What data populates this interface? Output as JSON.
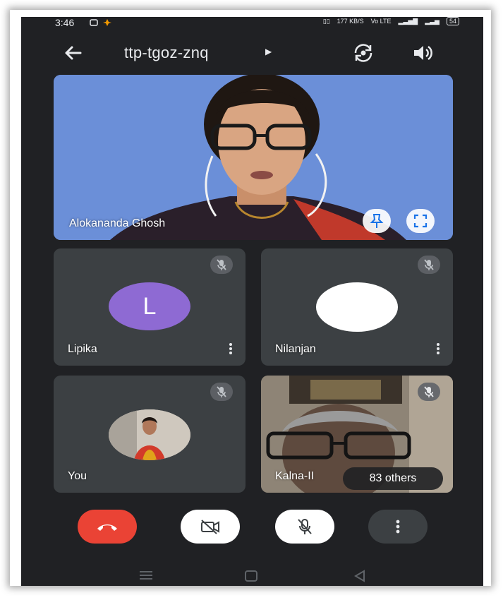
{
  "status_bar": {
    "time": "3:46",
    "network_speed": "177\nKB/S",
    "battery": "54"
  },
  "header": {
    "meeting_code": "ttp-tgoz-znq"
  },
  "main_tile": {
    "participant_name": "Alokananda Ghosh"
  },
  "tiles": [
    {
      "participant_name": "Lipika",
      "avatar_initial": "L",
      "avatar_color": "#8e6ad3",
      "muted": true
    },
    {
      "participant_name": "Nilanjan",
      "avatar_initial": "",
      "avatar_color": "#ffffff",
      "muted": true
    },
    {
      "participant_name": "You",
      "muted": true
    },
    {
      "participant_name": "Kalna-II",
      "others_label": "83 others",
      "muted": true
    }
  ],
  "controls": {
    "end_call_color": "#ea4335",
    "icons": [
      "end-call-icon",
      "camera-off-icon",
      "mic-off-icon",
      "more-vert-icon"
    ]
  }
}
